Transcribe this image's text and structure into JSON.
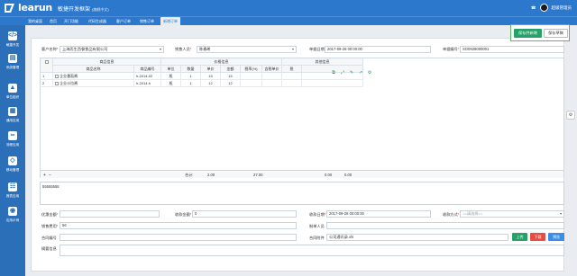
{
  "header": {
    "logo_text": "learun",
    "title": "敏捷开发框架",
    "subtitle": "(旗舰中文)",
    "username": "超级管理员"
  },
  "nav_tabs": [
    {
      "label": "我的桌面"
    },
    {
      "label": "首页"
    },
    {
      "label": "开门功能"
    },
    {
      "label": "代码生成器"
    },
    {
      "label": "客户订单"
    },
    {
      "label": "销售订单"
    },
    {
      "label": "新增订单"
    }
  ],
  "sidebar": [
    {
      "label": "敏捷开发",
      "icon": "code-icon"
    },
    {
      "label": "系统管理",
      "icon": "monitor-icon"
    },
    {
      "label": "单位组织",
      "icon": "org-icon"
    },
    {
      "label": "通用应用",
      "icon": "grid-icon"
    },
    {
      "label": "流程应用",
      "icon": "share-icon"
    },
    {
      "label": "移动管理",
      "icon": "mobile-icon"
    },
    {
      "label": "报表应用",
      "icon": "report-icon"
    },
    {
      "label": "应用示例",
      "icon": "sample-icon"
    }
  ],
  "actions": {
    "save_next": "保存并新增",
    "save": "保存草稿"
  },
  "form": {
    "customer_label": "客户名称",
    "customer_value": "上海而生西餐食品有限公司",
    "seller_label": "销售人员",
    "seller_value": "陈春希",
    "order_date_label": "单据日期",
    "order_date_value": "2017-09-28 00:00:00",
    "order_no_label": "单据编号",
    "order_no_value": "SO0928000001"
  },
  "grid": {
    "group_goods": "商品信息",
    "group_price": "价格信息",
    "group_other": "其他信息",
    "columns": [
      "商品名称",
      "商品编号",
      "单位",
      "数量",
      "单价",
      "金额",
      "税率(%)",
      "含税单价",
      "税",
      ""
    ],
    "rows": [
      {
        "num": "1",
        "name": "企业番茄酱",
        "code": "h-2014-02",
        "unit": "瓶",
        "qty": "1",
        "price": "15",
        "amount": "15"
      },
      {
        "num": "2",
        "name": "企业沙拉酱",
        "code": "h-2014-h",
        "unit": "瓶",
        "qty": "1",
        "price": "12",
        "amount": "12"
      }
    ],
    "footer_label": "合计:",
    "footer_qty": "2.00",
    "footer_amount": "27.00",
    "footer_tax1": "0.00",
    "footer_tax2": "0.00",
    "add_symbol": "+",
    "remove_symbol": "−"
  },
  "remark": {
    "value": "55555555"
  },
  "bottom": {
    "discount_label": "优惠金额",
    "received_label": "收款金额",
    "received_value": "0",
    "receipt_date_label": "收款日期",
    "receipt_date_value": "2017-09-28 00:00:00",
    "payment_label": "收款方式",
    "payment_placeholder": "==请选择==",
    "contact_label": "销售费用",
    "contact_value": "56",
    "manager_label": "制单人员",
    "contract_label": "合同编号",
    "attachment_label": "合同附件",
    "attachment_value": "公司通讯录.xls",
    "upload": "上传",
    "download": "下载",
    "preview": "预览",
    "desc_label": "摘要信息"
  },
  "colors": {
    "primary": "#2b78cd",
    "sidebar": "#2b6fb8",
    "success": "#26a269",
    "danger": "#e54d42",
    "info": "#3a8ee6"
  }
}
